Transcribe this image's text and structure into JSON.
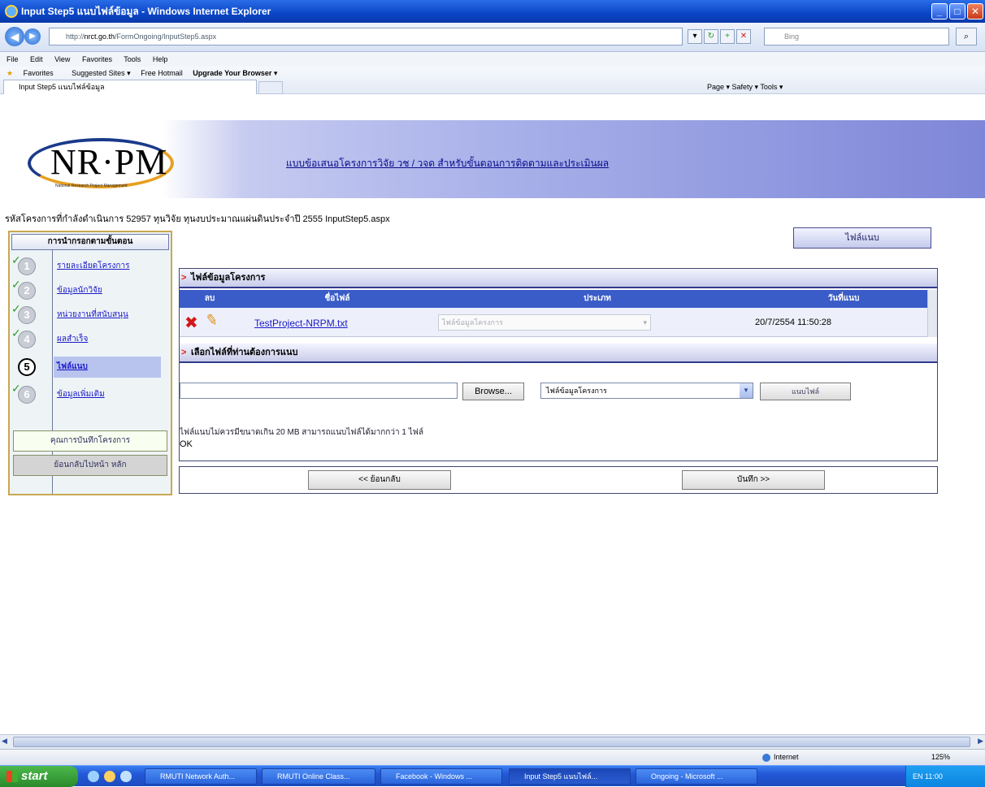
{
  "window": {
    "title": "Input Step5 แนบไฟล์ข้อมูล - Windows Internet Explorer"
  },
  "browser": {
    "url_prefix": "http://",
    "url_host": "nrct.go.th",
    "url_path": "/FormOngoing/InputStep5.aspx",
    "search_placeholder": "Bing",
    "menu": [
      "File",
      "Edit",
      "View",
      "Favorites",
      "Tools",
      "Help"
    ],
    "favorites": [
      "Favorites",
      "Suggested Sites ▾",
      "Free Hotmail",
      "Upgrade Your Browser ▾"
    ],
    "tab_title": "Input Step5 แนบไฟล์ข้อมูล",
    "commands": "Page ▾   Safety ▾   Tools ▾"
  },
  "page": {
    "logo_text": "NR·PM",
    "logo_sub": "National Research Project Management",
    "banner_title": "แบบข้อเสนอโครงการวิจัย วช / วจด สำหรับขั้นตอนการติดตามและประเมินผล",
    "project_info": "รหัสโครงการที่กำลังดำเนินการ 52957 ทุนวิจัย ทุนงบประมาณแผ่นดินประจำปี 2555 InputStep5.aspx",
    "attach_top_button": "ไฟล์แนบ",
    "sidebar": {
      "heading": "การนำกรอกตามขั้นตอน",
      "steps": [
        {
          "num": "1",
          "label": "รายละเอียดโครงการ",
          "done": true
        },
        {
          "num": "2",
          "label": "ข้อมูลนักวิจัย",
          "done": true
        },
        {
          "num": "3",
          "label": "หน่วยงานที่สนับสนุน",
          "done": true
        },
        {
          "num": "4",
          "label": "ผลสำเร็จ",
          "done": true
        },
        {
          "num": "5",
          "label": "ไฟล์แนบ",
          "done": false
        },
        {
          "num": "6",
          "label": "ข้อมูลเพิ่มเติม",
          "done": true
        }
      ],
      "btn_save_project": "คุณการบันทึกโครงการ",
      "btn_back_main": "ย้อนกลับไปหน้า หลัก"
    },
    "section1_title": "ไฟล์ข้อมูลโครงการ",
    "table": {
      "headers": [
        "ลบ",
        "ชื่อไฟล์",
        "ประเภท",
        "วันที่แนบ"
      ],
      "row": {
        "file_name": "TestProject-NRPM.txt",
        "type": "ไฟล์ข้อมูลโครงการ",
        "date": "20/7/2554 11:50:28"
      }
    },
    "section2_title": "เลือกไฟล์ที่ท่านต้องการแนบ",
    "browse_label": "Browse...",
    "type_select_value": "ไฟล์ข้อมูลโครงการ",
    "attach_button": "แนบไฟล์",
    "note": "ไฟล์แนบไม่ควรมีขนาดเกิน 20 MB สามารถแนบไฟล์ได้มากกว่า 1 ไฟล์",
    "ok_text": "OK",
    "back_button": "<< ย้อนกลับ",
    "save_button": "บันทึก >>"
  },
  "status": {
    "zone": "Internet",
    "zoom": "125%"
  },
  "taskbar": {
    "start": "start",
    "tasks": [
      "RMUTI Network Auth...",
      "RMUTI Online Class...",
      "Facebook - Windows ...",
      "Input Step5 แนบไฟล์...",
      "Ongoing - Microsoft ..."
    ],
    "clock": "EN  11:00"
  }
}
